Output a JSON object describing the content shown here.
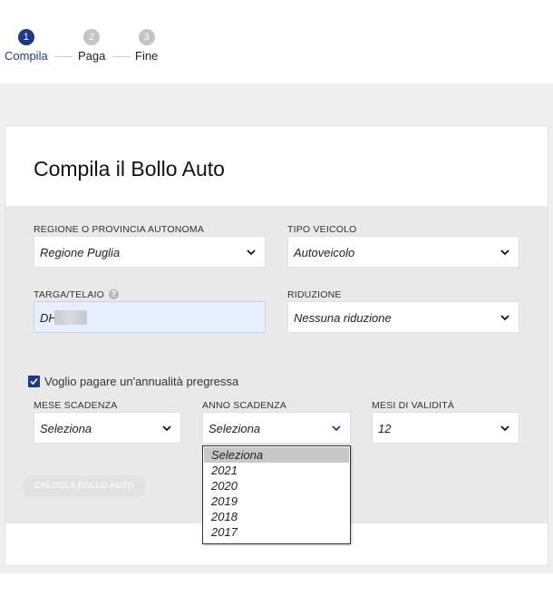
{
  "stepper": {
    "steps": [
      {
        "number": "1",
        "label": "Compila"
      },
      {
        "number": "2",
        "label": "Paga"
      },
      {
        "number": "3",
        "label": "Fine"
      }
    ]
  },
  "form": {
    "title": "Compila il Bollo Auto",
    "regione": {
      "label": "REGIONE O PROVINCIA AUTONOMA",
      "value": "Regione Puglia"
    },
    "tipo_veicolo": {
      "label": "TIPO VEICOLO",
      "value": "Autoveicolo"
    },
    "targa": {
      "label": "TARGA/TELAIO",
      "value": "DH",
      "info_icon": "question-icon"
    },
    "riduzione": {
      "label": "RIDUZIONE",
      "value": "Nessuna riduzione"
    },
    "annualita": {
      "label": "Voglio pagare un'annualità pregressa",
      "checked": true
    },
    "mese_scadenza": {
      "label": "MESE SCADENZA",
      "value": "Seleziona"
    },
    "anno_scadenza": {
      "label": "ANNO SCADENZA",
      "value": "Seleziona"
    },
    "mesi_validita": {
      "label": "MESI DI VALIDITÀ",
      "value": "12"
    },
    "calc_button": "CALCOLA BOLLO AUTO"
  },
  "anno_dropdown": {
    "options": [
      "Seleziona",
      "2021",
      "2020",
      "2019",
      "2018",
      "2017"
    ],
    "selected": "Seleziona"
  },
  "colors": {
    "accent": "#1d3a8a",
    "panel": "#e9e9e9",
    "input_focus": "#e6efff"
  }
}
